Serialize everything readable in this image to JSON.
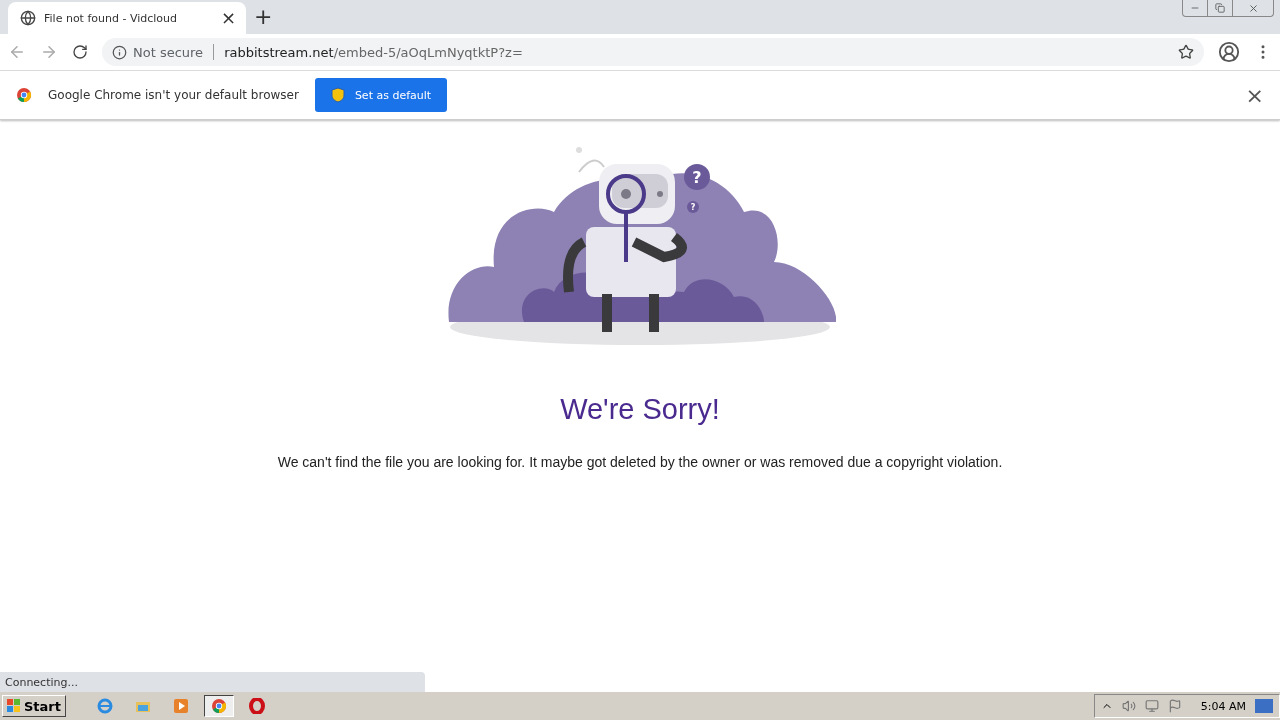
{
  "tabs": [
    {
      "title": "File not found - Vidcloud",
      "selected": true,
      "close": "×"
    }
  ],
  "new_tab": "+",
  "address_bar": {
    "security": "Not secure",
    "host": "rabbitstream.net",
    "path": "/embed-5/aOqLmNyqtktP?z="
  },
  "infobar": {
    "message": "Google Chrome isn't your default browser",
    "button": "Set as default",
    "close": "×"
  },
  "illustration": {
    "marks": [
      "?",
      "?"
    ]
  },
  "heading": "We're Sorry!",
  "message": "We can't find the file you are looking for. It maybe got deleted by the owner or was removed due a copyright violation.",
  "status_bubble": "Connecting...",
  "taskbar": {
    "start": "Start",
    "apps": [
      {
        "kind": "ie",
        "selected": false
      },
      {
        "kind": "explorer",
        "selected": false
      },
      {
        "kind": "media",
        "selected": false
      },
      {
        "kind": "chrome",
        "selected": true
      },
      {
        "kind": "opera",
        "selected": false
      }
    ],
    "clock": "5:04 AM"
  }
}
